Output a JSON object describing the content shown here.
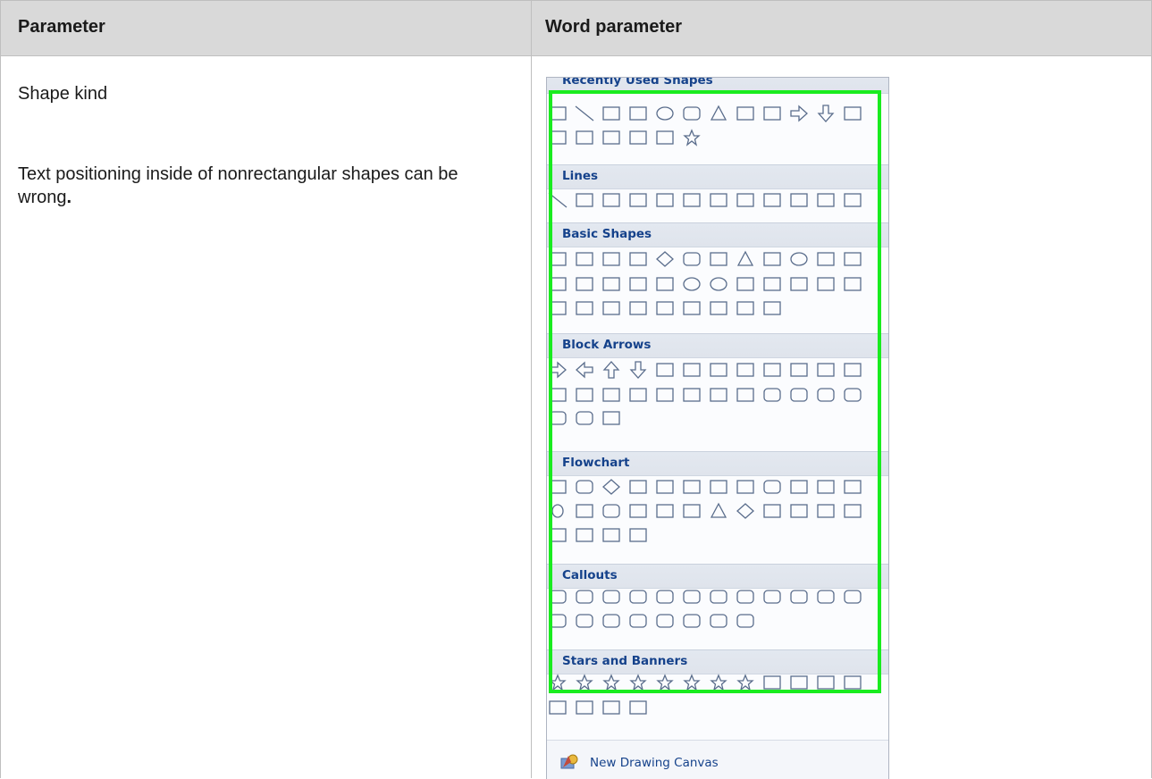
{
  "table": {
    "header": {
      "col1": "Parameter",
      "col2": "Word parameter"
    },
    "row": {
      "param_name": "Shape kind",
      "note": "Text positioning inside of nonrectangular shapes can be wrong",
      "note_end": "."
    }
  },
  "gallery": {
    "sections": [
      {
        "label": "Recently Used Shapes"
      },
      {
        "label": "Lines"
      },
      {
        "label": "Basic Shapes"
      },
      {
        "label": "Block Arrows"
      },
      {
        "label": "Flowchart"
      },
      {
        "label": "Callouts"
      },
      {
        "label": "Stars and Banners"
      }
    ],
    "new_canvas": "New Drawing Canvas",
    "icon_stroke": "#5a6d8c",
    "highlight_color": "#19ec1f"
  }
}
